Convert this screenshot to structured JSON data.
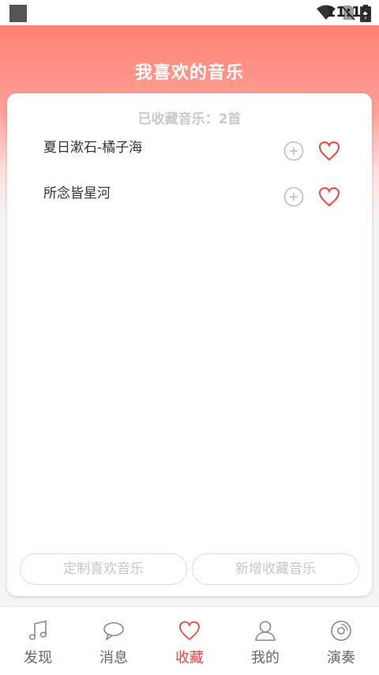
{
  "status_bar": {
    "time": "11:15"
  },
  "header": {
    "title": "我喜欢的音乐"
  },
  "favorites": {
    "count_label": "已收藏音乐：2首",
    "songs": [
      {
        "title": "夏日漱石-橘子海"
      },
      {
        "title": "所念皆星河"
      }
    ]
  },
  "actions": {
    "customize_label": "定制喜欢音乐",
    "add_label": "新增收藏音乐"
  },
  "tabs": [
    {
      "label": "发现",
      "icon": "music-note-icon"
    },
    {
      "label": "消息",
      "icon": "chat-bubble-icon"
    },
    {
      "label": "收藏",
      "icon": "heart-icon",
      "active": true
    },
    {
      "label": "我的",
      "icon": "person-icon"
    },
    {
      "label": "演奏",
      "icon": "disc-icon"
    }
  ],
  "colors": {
    "accent": "#f0433e",
    "header_top": "#ff7f73"
  }
}
